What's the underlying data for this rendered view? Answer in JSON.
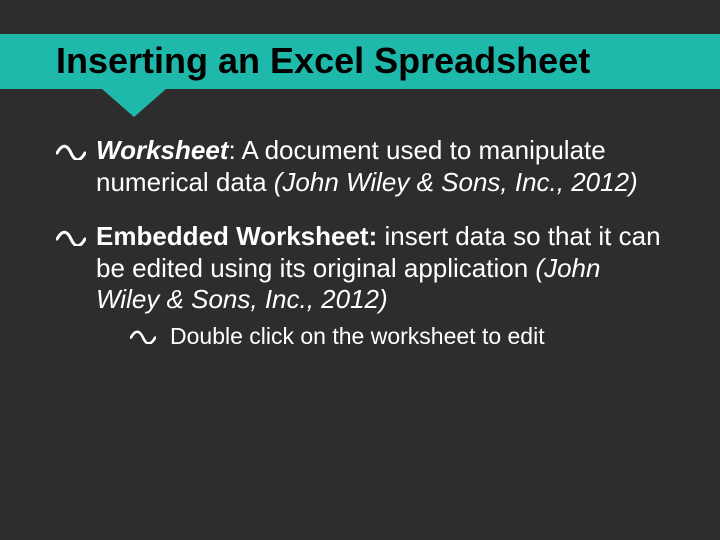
{
  "title": "Inserting an Excel Spreadsheet",
  "bullets": {
    "b1": {
      "term": "Worksheet",
      "sep": ": ",
      "def": "A document used to manipulate numerical data ",
      "cite": "(John Wiley & Sons, Inc., 2012)"
    },
    "b2": {
      "term": "Embedded Worksheet",
      "sep": ": ",
      "def": "insert data so that it can be edited using its original application ",
      "cite": "(John Wiley & Sons, Inc., 2012)"
    },
    "b2a": {
      "text": "Double click on the worksheet to edit"
    }
  }
}
